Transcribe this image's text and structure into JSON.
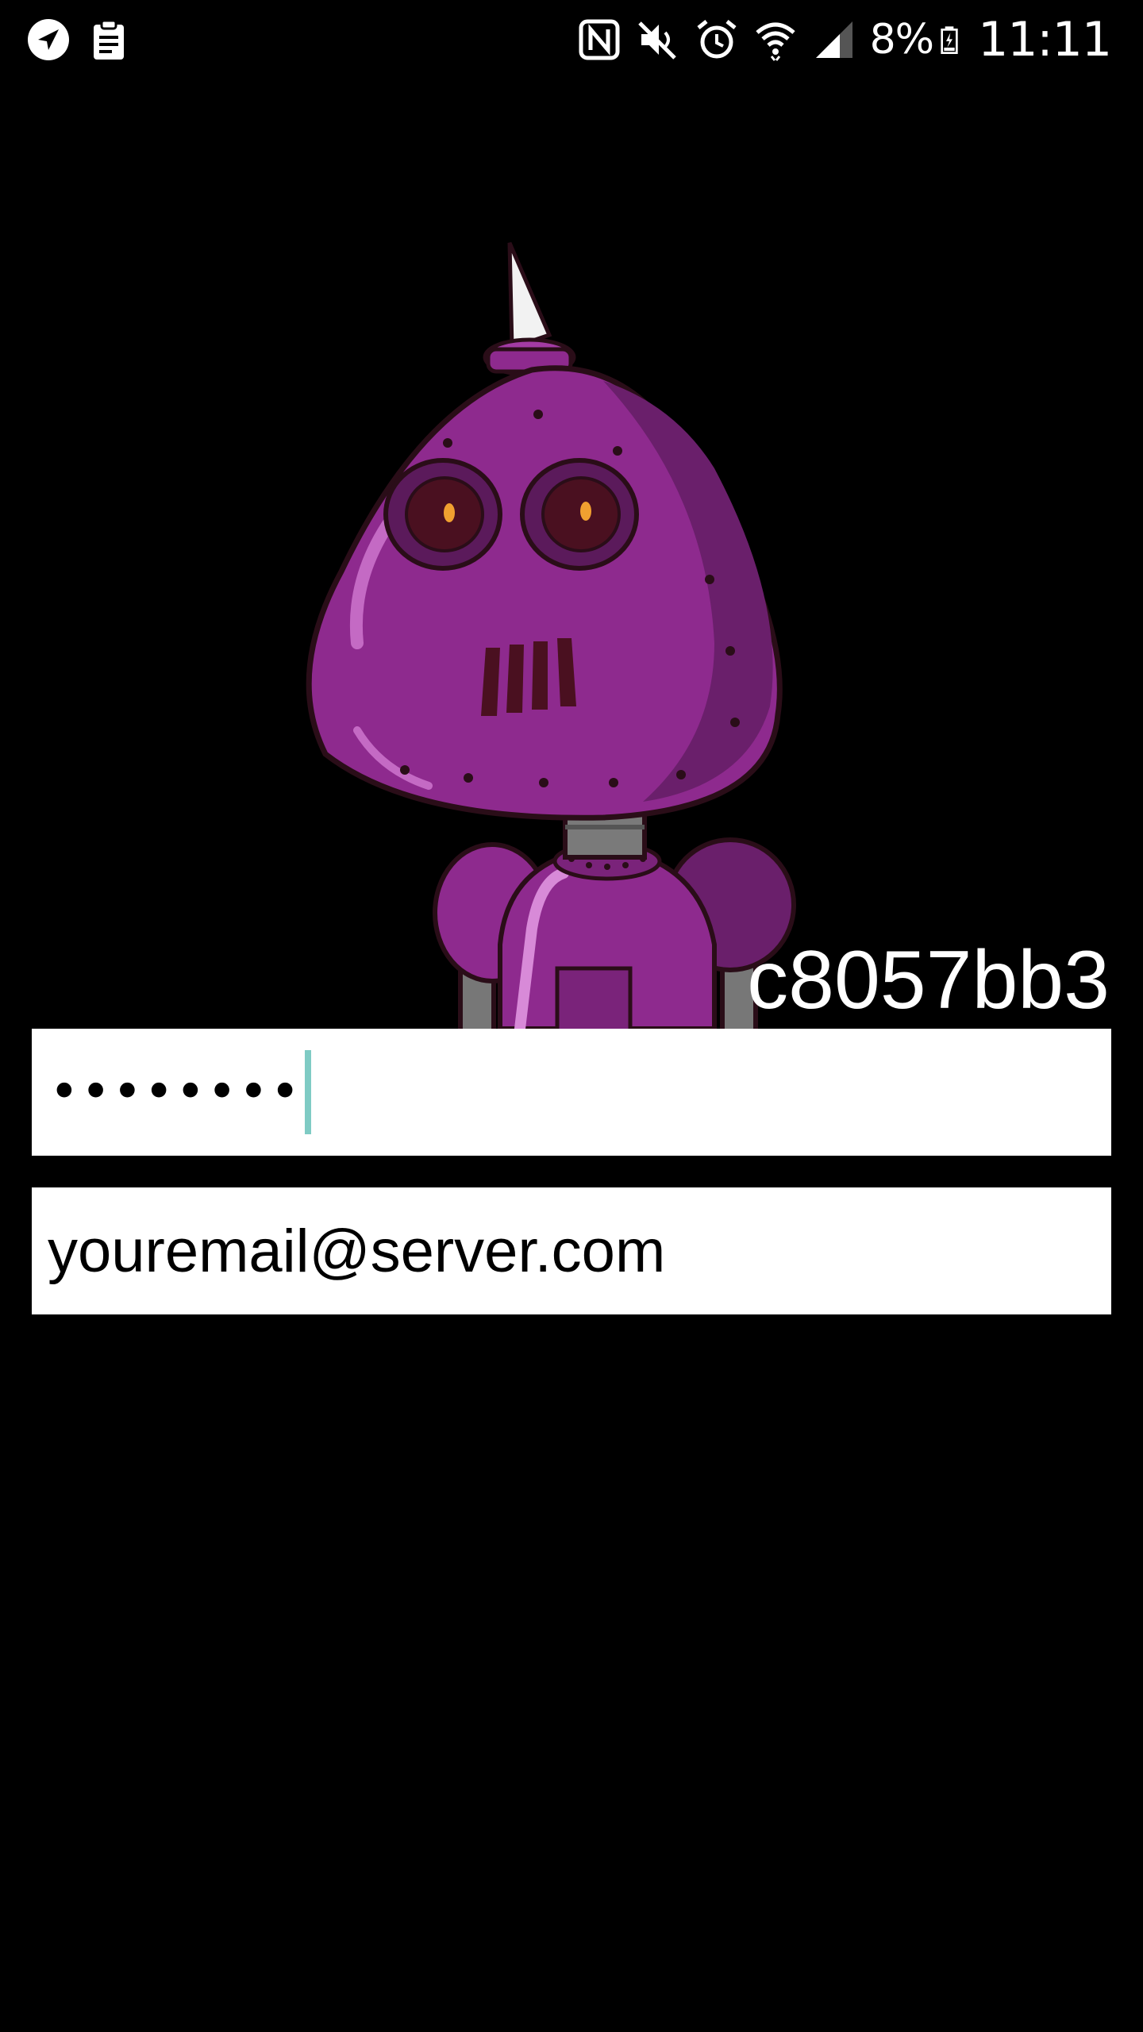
{
  "status_bar": {
    "left_icons": [
      "navigation-icon",
      "clipboard-icon"
    ],
    "right_icons": [
      "nfc-icon",
      "mute-icon",
      "alarm-icon",
      "wifi-icon",
      "signal-icon"
    ],
    "battery_percent": "8%",
    "battery_icon": "battery-charging-icon",
    "time": "11:11"
  },
  "avatar": {
    "icon": "robot-avatar",
    "colors": {
      "body": "#8e2a8e",
      "body_dark": "#6a1f6b",
      "outline": "#3a1020",
      "eye_glow": "#f0a030",
      "neck": "#7a7a7a",
      "horn": "#f2f2f2"
    }
  },
  "username": "c8057bb3",
  "password_field": {
    "masked_value": "••••••••",
    "caret_color": "#7fcbc4"
  },
  "email_field": {
    "placeholder": "youremail@server.com"
  }
}
